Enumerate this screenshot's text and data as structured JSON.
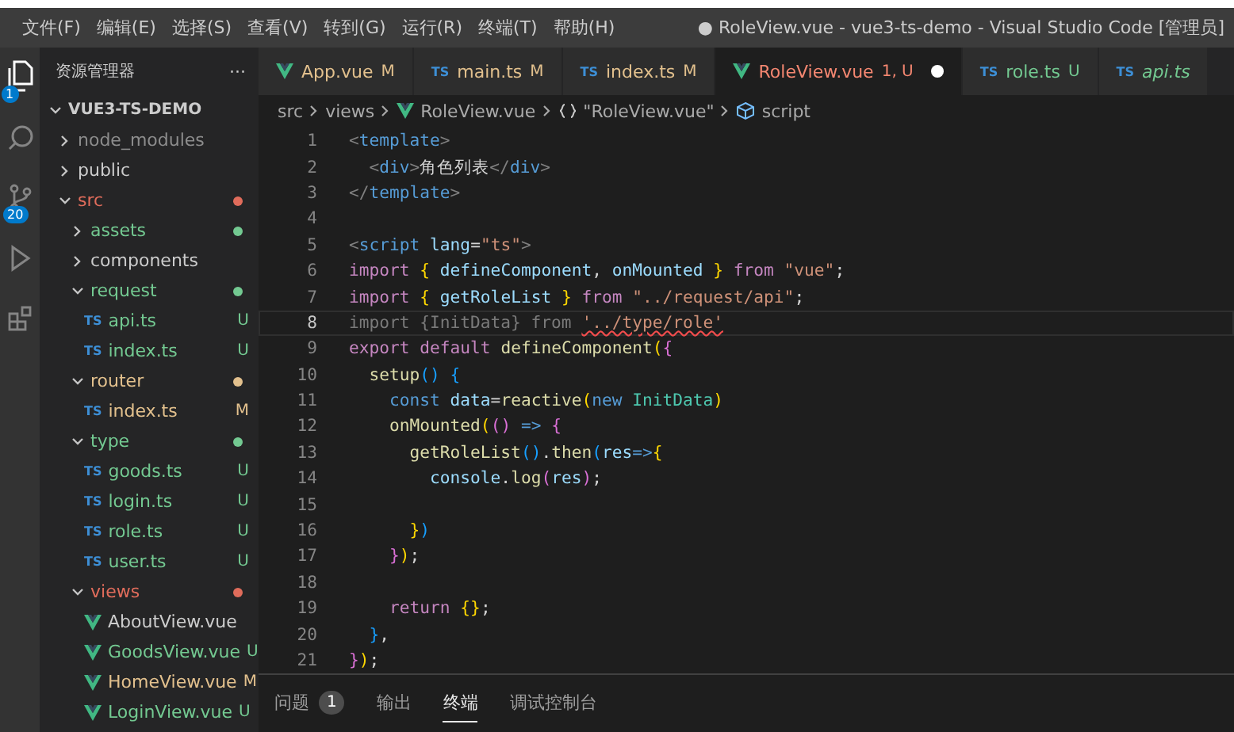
{
  "menu": [
    "文件(F)",
    "编辑(E)",
    "选择(S)",
    "查看(V)",
    "转到(G)",
    "运行(R)",
    "终端(T)",
    "帮助(H)"
  ],
  "window": {
    "title": "● RoleView.vue - vue3-ts-demo - Visual Studio Code [管理员]"
  },
  "activity_bar": [
    {
      "kind": "files",
      "badge": "1",
      "selected": true
    },
    {
      "kind": "search",
      "selected": false
    },
    {
      "kind": "source-control",
      "badge": "20",
      "selected": false
    },
    {
      "kind": "run",
      "selected": false
    },
    {
      "kind": "extensions",
      "selected": false
    }
  ],
  "sidebar": {
    "title": "资源管理器",
    "more": "···",
    "project": {
      "name": "VUE3-TS-DEMO",
      "expanded": true,
      "children": [
        {
          "name": "node_modules",
          "kind": "folder",
          "expanded": false,
          "color": "#8c8c8c",
          "dot": false
        },
        {
          "name": "public",
          "kind": "folder",
          "expanded": false,
          "color": "#cccccc",
          "dot": false
        },
        {
          "name": "src",
          "kind": "folder",
          "expanded": true,
          "color": "#e06c5b",
          "dot": true,
          "children": [
            {
              "name": "assets",
              "kind": "folder",
              "expanded": false,
              "color": "#73c991",
              "dot": true
            },
            {
              "name": "components",
              "kind": "folder",
              "expanded": false,
              "color": "#cccccc",
              "dot": false
            },
            {
              "name": "request",
              "kind": "folder",
              "expanded": true,
              "color": "#73c991",
              "dot": true,
              "children": [
                {
                  "name": "api.ts",
                  "kind": "ts",
                  "icon_label": "TS",
                  "status": "U",
                  "color": "#73c991"
                },
                {
                  "name": "index.ts",
                  "kind": "ts",
                  "icon_label": "TS",
                  "status": "U",
                  "color": "#73c991"
                }
              ]
            },
            {
              "name": "router",
              "kind": "folder",
              "expanded": true,
              "color": "#e2c08d",
              "dot": true,
              "children": [
                {
                  "name": "index.ts",
                  "kind": "ts",
                  "icon_label": "TS",
                  "status": "M",
                  "color": "#e2c08d"
                }
              ]
            },
            {
              "name": "type",
              "kind": "folder",
              "expanded": true,
              "color": "#73c991",
              "dot": true,
              "children": [
                {
                  "name": "goods.ts",
                  "kind": "ts",
                  "icon_label": "TS",
                  "status": "U",
                  "color": "#73c991"
                },
                {
                  "name": "login.ts",
                  "kind": "ts",
                  "icon_label": "TS",
                  "status": "U",
                  "color": "#73c991"
                },
                {
                  "name": "role.ts",
                  "kind": "ts",
                  "icon_label": "TS",
                  "status": "U",
                  "color": "#73c991"
                },
                {
                  "name": "user.ts",
                  "kind": "ts",
                  "icon_label": "TS",
                  "status": "U",
                  "color": "#73c991"
                }
              ]
            },
            {
              "name": "views",
              "kind": "folder",
              "expanded": true,
              "color": "#e06c5b",
              "dot": true,
              "children": [
                {
                  "name": "AboutView.vue",
                  "kind": "vue",
                  "color": "#cccccc"
                },
                {
                  "name": "GoodsView.vue",
                  "kind": "vue",
                  "status": "U",
                  "color": "#73c991"
                },
                {
                  "name": "HomeView.vue",
                  "kind": "vue",
                  "status": "M",
                  "color": "#e2c08d"
                },
                {
                  "name": "LoginView.vue",
                  "kind": "vue",
                  "status": "U",
                  "color": "#73c991"
                }
              ]
            }
          ]
        }
      ]
    }
  },
  "tabs": [
    {
      "label": "App.vue",
      "kind": "vue",
      "status": "M",
      "color": "#e2c08d",
      "selected": false,
      "dirty": false,
      "preview": false
    },
    {
      "label": "main.ts",
      "kind": "ts",
      "icon_label": "TS",
      "status": "M",
      "color": "#e2c08d",
      "selected": false,
      "dirty": false,
      "preview": false
    },
    {
      "label": "index.ts",
      "kind": "ts",
      "icon_label": "TS",
      "status": "M",
      "color": "#e2c08d",
      "selected": false,
      "dirty": false,
      "preview": false
    },
    {
      "label": "RoleView.vue",
      "kind": "vue",
      "status": "1, U",
      "color": "#f48771",
      "selected": true,
      "dirty": true,
      "preview": false
    },
    {
      "label": "role.ts",
      "kind": "ts",
      "icon_label": "TS",
      "status": "U",
      "color": "#73c991",
      "selected": false,
      "dirty": false,
      "preview": false
    },
    {
      "label": "api.ts",
      "kind": "ts",
      "icon_label": "TS",
      "color": "#73c991",
      "selected": false,
      "dirty": false,
      "preview": true
    }
  ],
  "breadcrumbs": [
    {
      "text": "src",
      "kind": "folder"
    },
    {
      "text": "views",
      "kind": "folder"
    },
    {
      "text": "RoleView.vue",
      "kind": "vue"
    },
    {
      "text": "\"RoleView.vue\"",
      "kind": "object"
    },
    {
      "text": "script",
      "kind": "module"
    }
  ],
  "editor": {
    "lines": [
      {
        "num": "1",
        "current": false,
        "tokens": [
          {
            "text": "<",
            "kind": "p"
          },
          {
            "text": "template",
            "kind": "tag"
          },
          {
            "text": ">",
            "kind": "p"
          }
        ]
      },
      {
        "num": "2",
        "current": false,
        "tokens": [
          {
            "text": "  <",
            "kind": "p"
          },
          {
            "text": "div",
            "kind": "tag"
          },
          {
            "text": ">",
            "kind": "p"
          },
          {
            "text": "角色列表",
            "kind": "t"
          },
          {
            "text": "</",
            "kind": "p"
          },
          {
            "text": "div",
            "kind": "tag"
          },
          {
            "text": ">",
            "kind": "p"
          }
        ]
      },
      {
        "num": "3",
        "current": false,
        "tokens": [
          {
            "text": "</",
            "kind": "p"
          },
          {
            "text": "template",
            "kind": "tag"
          },
          {
            "text": ">",
            "kind": "p"
          }
        ]
      },
      {
        "num": "4",
        "current": false
      },
      {
        "num": "5",
        "current": false,
        "tokens": [
          {
            "text": "<",
            "kind": "p"
          },
          {
            "text": "script ",
            "kind": "tag"
          },
          {
            "text": "lang",
            "kind": "attr"
          },
          {
            "text": "=",
            "kind": "t"
          },
          {
            "text": "\"ts\"",
            "kind": "str"
          },
          {
            "text": ">",
            "kind": "p"
          }
        ]
      },
      {
        "num": "6",
        "current": false,
        "tokens": [
          {
            "text": "import ",
            "kind": "kw"
          },
          {
            "text": "{ ",
            "kind": "b1"
          },
          {
            "text": "defineComponent",
            "kind": "var"
          },
          {
            "text": ", ",
            "kind": "t"
          },
          {
            "text": "onMounted ",
            "kind": "var"
          },
          {
            "text": "} ",
            "kind": "b1"
          },
          {
            "text": "from ",
            "kind": "kw"
          },
          {
            "text": "\"vue\"",
            "kind": "str"
          },
          {
            "text": ";",
            "kind": "t"
          }
        ]
      },
      {
        "num": "7",
        "current": false,
        "tokens": [
          {
            "text": "import ",
            "kind": "kw"
          },
          {
            "text": "{ ",
            "kind": "b1"
          },
          {
            "text": "getRoleList ",
            "kind": "var"
          },
          {
            "text": "} ",
            "kind": "b1"
          },
          {
            "text": "from ",
            "kind": "kw"
          },
          {
            "text": "\"../request/api\"",
            "kind": "str"
          },
          {
            "text": ";",
            "kind": "t"
          }
        ]
      },
      {
        "num": "8",
        "current": true,
        "tokens": [
          {
            "text": "import {InitData} from ",
            "kind": "faded"
          },
          {
            "text": "'../type/role'",
            "kind": "err"
          }
        ]
      },
      {
        "num": "9",
        "current": false,
        "tokens": [
          {
            "text": "export ",
            "kind": "kw"
          },
          {
            "text": "default ",
            "kind": "kw"
          },
          {
            "text": "defineComponent",
            "kind": "fn"
          },
          {
            "text": "(",
            "kind": "b1"
          },
          {
            "text": "{",
            "kind": "b2"
          }
        ]
      },
      {
        "num": "10",
        "current": false,
        "tokens": [
          {
            "text": "  setup",
            "kind": "fn"
          },
          {
            "text": "() {",
            "kind": "b3"
          }
        ]
      },
      {
        "num": "11",
        "current": false,
        "tokens": [
          {
            "text": "    const ",
            "kind": "st"
          },
          {
            "text": "data",
            "kind": "var"
          },
          {
            "text": "=",
            "kind": "t"
          },
          {
            "text": "reactive",
            "kind": "fn"
          },
          {
            "text": "(",
            "kind": "b1"
          },
          {
            "text": "new ",
            "kind": "st"
          },
          {
            "text": "InitData",
            "kind": "cls"
          },
          {
            "text": ")",
            "kind": "b1"
          }
        ]
      },
      {
        "num": "12",
        "current": false,
        "tokens": [
          {
            "text": "    onMounted",
            "kind": "fn"
          },
          {
            "text": "(",
            "kind": "b1"
          },
          {
            "text": "() ",
            "kind": "b2"
          },
          {
            "text": "=> ",
            "kind": "st"
          },
          {
            "text": "{",
            "kind": "b2"
          }
        ]
      },
      {
        "num": "13",
        "current": false,
        "tokens": [
          {
            "text": "      getRoleList",
            "kind": "fn"
          },
          {
            "text": "()",
            "kind": "b3"
          },
          {
            "text": ".",
            "kind": "t"
          },
          {
            "text": "then",
            "kind": "fn"
          },
          {
            "text": "(",
            "kind": "b3"
          },
          {
            "text": "res",
            "kind": "var"
          },
          {
            "text": "=>",
            "kind": "st"
          },
          {
            "text": "{",
            "kind": "b1"
          }
        ]
      },
      {
        "num": "14",
        "current": false,
        "tokens": [
          {
            "text": "        console",
            "kind": "var"
          },
          {
            "text": ".",
            "kind": "t"
          },
          {
            "text": "log",
            "kind": "fn"
          },
          {
            "text": "(",
            "kind": "b2"
          },
          {
            "text": "res",
            "kind": "var"
          },
          {
            "text": ")",
            "kind": "b2"
          },
          {
            "text": ";",
            "kind": "t"
          }
        ]
      },
      {
        "num": "15",
        "current": false
      },
      {
        "num": "16",
        "current": false,
        "tokens": [
          {
            "text": "      }",
            "kind": "b1"
          },
          {
            "text": ")",
            "kind": "b3"
          }
        ]
      },
      {
        "num": "17",
        "current": false,
        "tokens": [
          {
            "text": "    }",
            "kind": "b2"
          },
          {
            "text": ")",
            "kind": "b1"
          },
          {
            "text": ";",
            "kind": "t"
          }
        ]
      },
      {
        "num": "18",
        "current": false
      },
      {
        "num": "19",
        "current": false,
        "tokens": [
          {
            "text": "    return ",
            "kind": "kw"
          },
          {
            "text": "{}",
            "kind": "b1"
          },
          {
            "text": ";",
            "kind": "t"
          }
        ]
      },
      {
        "num": "20",
        "current": false,
        "tokens": [
          {
            "text": "  }",
            "kind": "b3"
          },
          {
            "text": ",",
            "kind": "t"
          }
        ]
      },
      {
        "num": "21",
        "current": false,
        "tokens": [
          {
            "text": "}",
            "kind": "b2"
          },
          {
            "text": ")",
            "kind": "b1"
          },
          {
            "text": ";",
            "kind": "t"
          }
        ]
      }
    ]
  },
  "panel": {
    "tabs": [
      {
        "label": "问题",
        "badge": "1",
        "selected": false
      },
      {
        "label": "输出",
        "selected": false
      },
      {
        "label": "终端",
        "selected": true
      },
      {
        "label": "调试控制台",
        "selected": false
      }
    ]
  }
}
